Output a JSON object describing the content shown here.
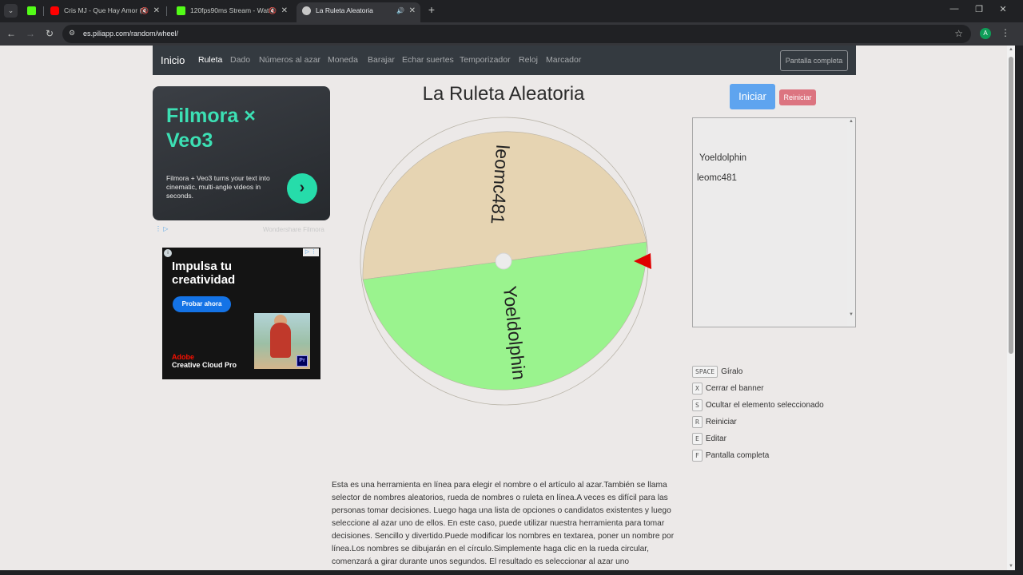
{
  "browser": {
    "tabs": [
      {
        "title": "",
        "favicon_color": "#53fc18"
      },
      {
        "title": "Cris MJ - Que Hay Amor (V",
        "favicon_color": "#ff0000"
      },
      {
        "title": "120fps90ms Stream - Watc",
        "favicon_color": "#53fc18"
      },
      {
        "title": "La Ruleta Aleatoria",
        "favicon_color": "#c7c7c7"
      }
    ],
    "url": "es.piliapp.com/random/wheel/",
    "profile_initial": "A"
  },
  "nav": {
    "brand": "Inicio",
    "links": [
      "Ruleta",
      "Dado",
      "Números al azar",
      "Moneda",
      "Barajar",
      "Echar suertes",
      "Temporizador",
      "Reloj",
      "Marcador"
    ],
    "fullscreen": "Pantalla completa"
  },
  "ads": {
    "filmora": {
      "title": "Filmora × Veo3",
      "body": "Filmora + Veo3 turns your text into cinematic, multi-angle videos in seconds.",
      "sponsor": "Wondershare Filmora"
    },
    "adobe": {
      "title": "Impulsa tu creatividad",
      "cta": "Probar ahora",
      "brand": "Adobe",
      "product": "Creative Cloud Pro",
      "app_badge": "Pr"
    }
  },
  "main": {
    "title": "La Ruleta Aleatoria",
    "start_button": "Iniciar",
    "reset_button": "Reiniciar"
  },
  "wheel": {
    "segments": [
      {
        "name": "leomc481",
        "color": "#e6d4b2"
      },
      {
        "name": "Yoeldolphin",
        "color": "#9af38e"
      }
    ],
    "pointer_color": "#e00000"
  },
  "names_box": {
    "lines": [
      "Yoeldolphin",
      "leomc481"
    ]
  },
  "shortcuts": [
    {
      "key": "SPACE",
      "label": "Gíralo"
    },
    {
      "key": "X",
      "label": "Cerrar el banner"
    },
    {
      "key": "S",
      "label": "Ocultar el elemento seleccionado"
    },
    {
      "key": "R",
      "label": "Reiniciar"
    },
    {
      "key": "E",
      "label": "Editar"
    },
    {
      "key": "F",
      "label": "Pantalla completa"
    }
  ],
  "description": "Esta es una herramienta en línea para elegir el nombre o el artículo al azar.También se llama selector de nombres aleatorios, rueda de nombres o ruleta en línea.A veces es difícil para las personas tomar decisiones. Luego haga una lista de opciones o candidatos existentes y luego seleccione al azar uno de ellos. En este caso, puede utilizar nuestra herramienta para tomar decisiones. Sencillo y divertido.Puede modificar los nombres en textarea, poner un nombre por línea.Los nombres se dibujarán en el círculo.Simplemente haga clic en la rueda circular, comenzará a girar durante unos segundos. El resultado es seleccionar al azar uno"
}
